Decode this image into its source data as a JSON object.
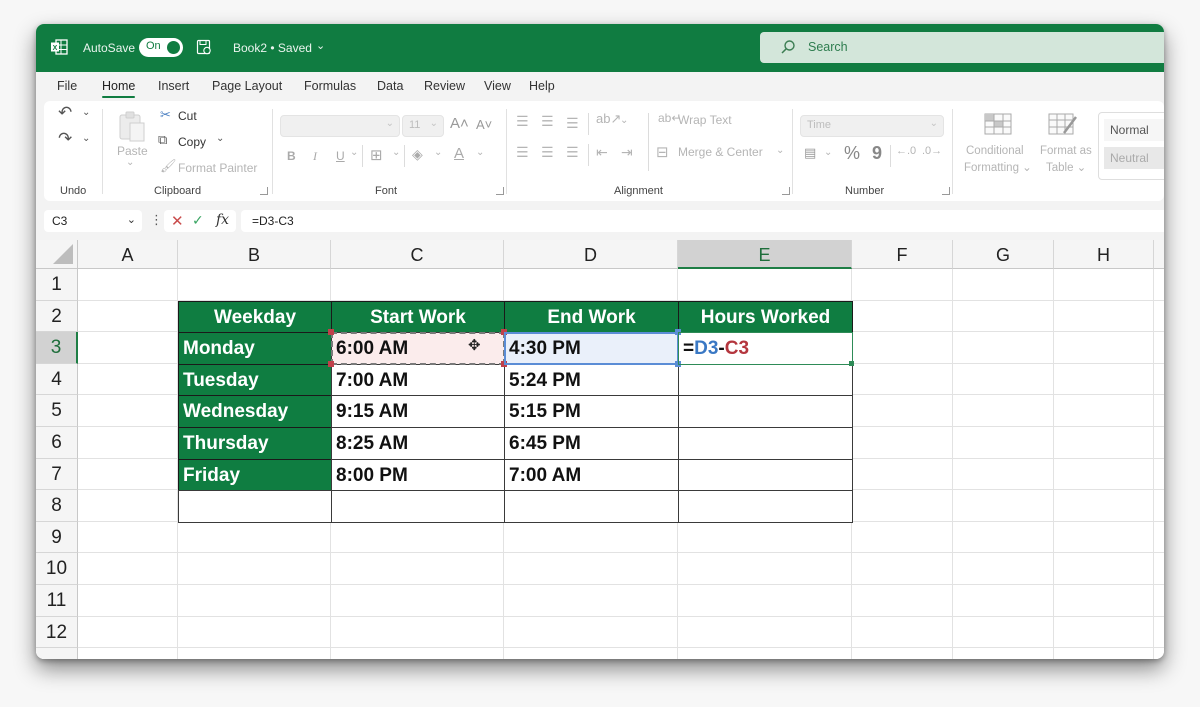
{
  "titlebar": {
    "app_icon": "excel-icon",
    "autosave_label": "AutoSave",
    "autosave_state": "On",
    "doc_title": "Book2 • Saved",
    "search_placeholder": "Search",
    "brand_color": "#107c41"
  },
  "menu": {
    "tabs": [
      {
        "label": "File"
      },
      {
        "label": "Home",
        "active": true
      },
      {
        "label": "Insert"
      },
      {
        "label": "Page Layout"
      },
      {
        "label": "Formulas"
      },
      {
        "label": "Data"
      },
      {
        "label": "Review"
      },
      {
        "label": "View"
      },
      {
        "label": "Help"
      }
    ]
  },
  "ribbon": {
    "groups": {
      "undo": "Undo",
      "clipboard": "Clipboard",
      "font": "Font",
      "alignment": "Alignment",
      "number": "Number"
    },
    "clipboard": {
      "paste": "Paste",
      "cut": "Cut",
      "copy": "Copy",
      "format_painter": "Format Painter"
    },
    "font": {
      "font_name": "",
      "font_size": "11",
      "bold": "B",
      "italic": "I",
      "underline": "U"
    },
    "alignment": {
      "wrap_text": "Wrap Text",
      "merge_center": "Merge & Center"
    },
    "number": {
      "format": "Time",
      "percent": "%",
      "comma": "9"
    },
    "styles": {
      "conditional_formatting": [
        "Conditional",
        "Formatting ⌄"
      ],
      "format_as_table": [
        "Format as",
        "Table ⌄"
      ],
      "normal": "Normal",
      "neutral": "Neutral"
    }
  },
  "formula_bar": {
    "name_box": "C3",
    "formula": "=D3-C3"
  },
  "sheet": {
    "columns": [
      "A",
      "B",
      "C",
      "D",
      "E",
      "F",
      "G",
      "H"
    ],
    "active_column": "E",
    "rows": [
      "1",
      "2",
      "3",
      "4",
      "5",
      "6",
      "7",
      "8",
      "9",
      "10",
      "11",
      "12"
    ],
    "active_row": "3",
    "table": {
      "headers": [
        "Weekday",
        "Start Work",
        "End Work",
        "Hours Worked"
      ],
      "rows": [
        {
          "day": "Monday",
          "start": "6:00 AM",
          "end": "4:30 PM",
          "hours": ""
        },
        {
          "day": "Tuesday",
          "start": "7:00 AM",
          "end": "5:24 PM",
          "hours": ""
        },
        {
          "day": "Wednesday",
          "start": "9:15 AM",
          "end": "5:15 PM",
          "hours": ""
        },
        {
          "day": "Thursday",
          "start": "8:25 AM",
          "end": "6:45 PM",
          "hours": ""
        },
        {
          "day": "Friday",
          "start": "8:00 PM",
          "end": "7:00 AM",
          "hours": ""
        }
      ]
    },
    "editing_cell": {
      "address": "E3",
      "prefix": "=",
      "ref1": "D3",
      "op": "-",
      "ref2": "C3"
    },
    "ref_colors": {
      "D3": "#3a78c4",
      "C3": "#b4363e"
    }
  }
}
